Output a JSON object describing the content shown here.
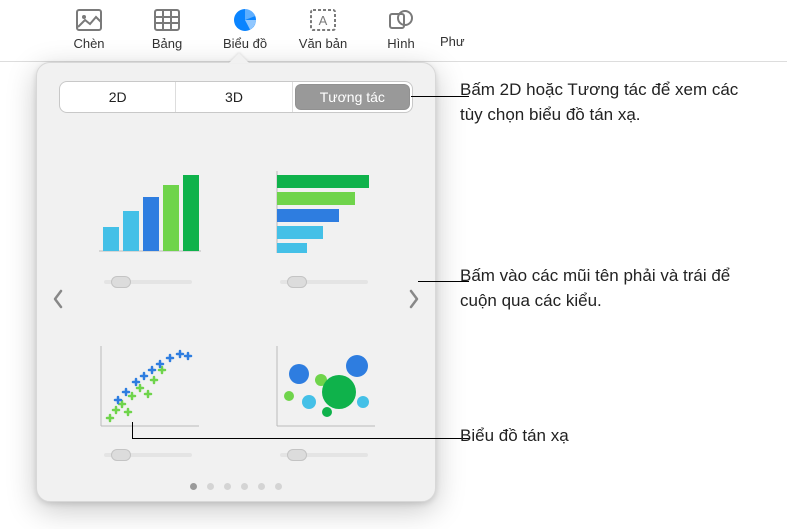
{
  "toolbar": {
    "items": [
      {
        "label": "Chèn",
        "icon": "insert"
      },
      {
        "label": "Bảng",
        "icon": "table"
      },
      {
        "label": "Biểu đồ",
        "icon": "chart",
        "active": true
      },
      {
        "label": "Văn bản",
        "icon": "text"
      },
      {
        "label": "Hình",
        "icon": "shapes"
      },
      {
        "label": "Phư",
        "icon": "media"
      }
    ]
  },
  "popover": {
    "tabs": {
      "t2d": "2D",
      "t3d": "3D",
      "interactive": "Tương tác"
    },
    "arrows": {
      "left": "prev-style",
      "right": "next-style"
    },
    "charts": [
      {
        "name": "interactive-column-chart"
      },
      {
        "name": "interactive-bar-chart"
      },
      {
        "name": "interactive-scatter-chart"
      },
      {
        "name": "interactive-bubble-chart"
      }
    ],
    "pager": {
      "count": 6,
      "active": 0
    }
  },
  "callouts": {
    "c1": "Bấm 2D hoặc Tương tác để xem các tùy chọn biểu đồ tán xạ.",
    "c2": "Bấm vào các mũi tên phải và trái để cuộn qua các kiểu.",
    "c3": "Biểu đồ tán xạ"
  }
}
